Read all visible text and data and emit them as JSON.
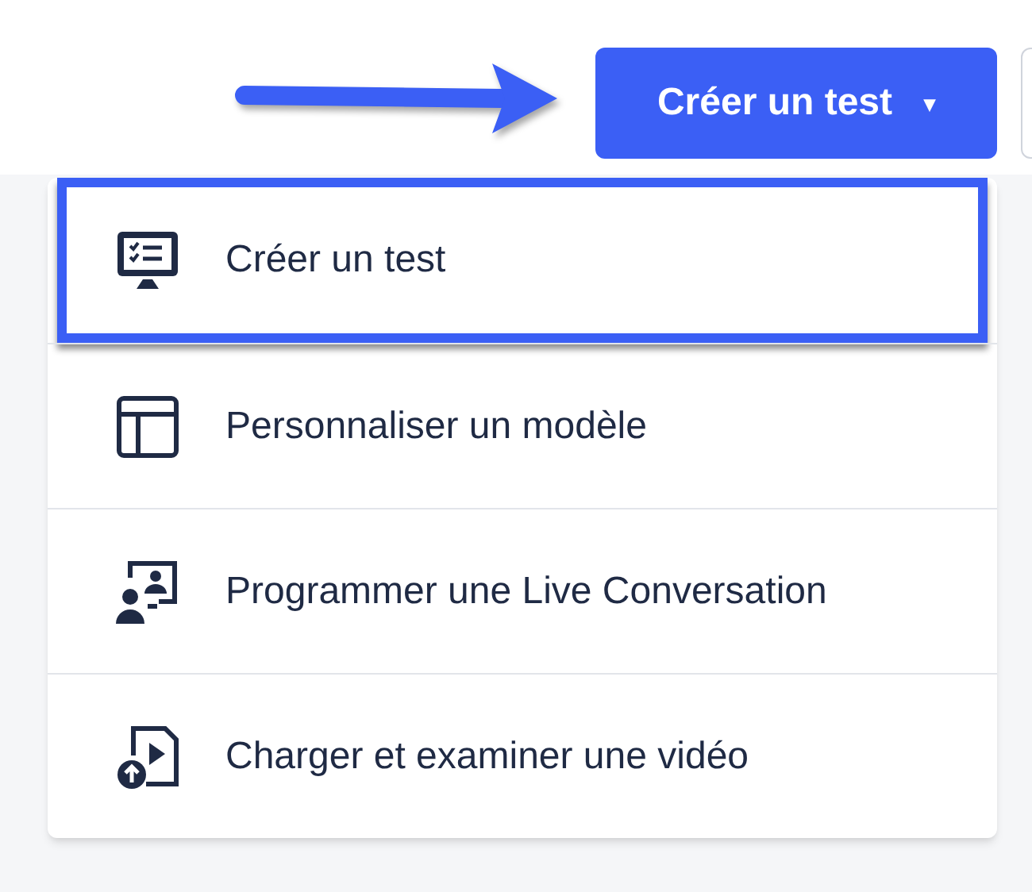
{
  "header": {
    "create_button": {
      "label": "Créer un test",
      "caret": "▾"
    }
  },
  "menu": {
    "items": [
      {
        "kind": "test",
        "label": "Créer un test",
        "highlighted": true
      },
      {
        "kind": "template",
        "label": "Personnaliser un modèle",
        "highlighted": false
      },
      {
        "kind": "live",
        "label": "Programmer une Live Conversation",
        "highlighted": false
      },
      {
        "kind": "video",
        "label": "Charger et examiner une vidéo",
        "highlighted": false
      }
    ]
  }
}
